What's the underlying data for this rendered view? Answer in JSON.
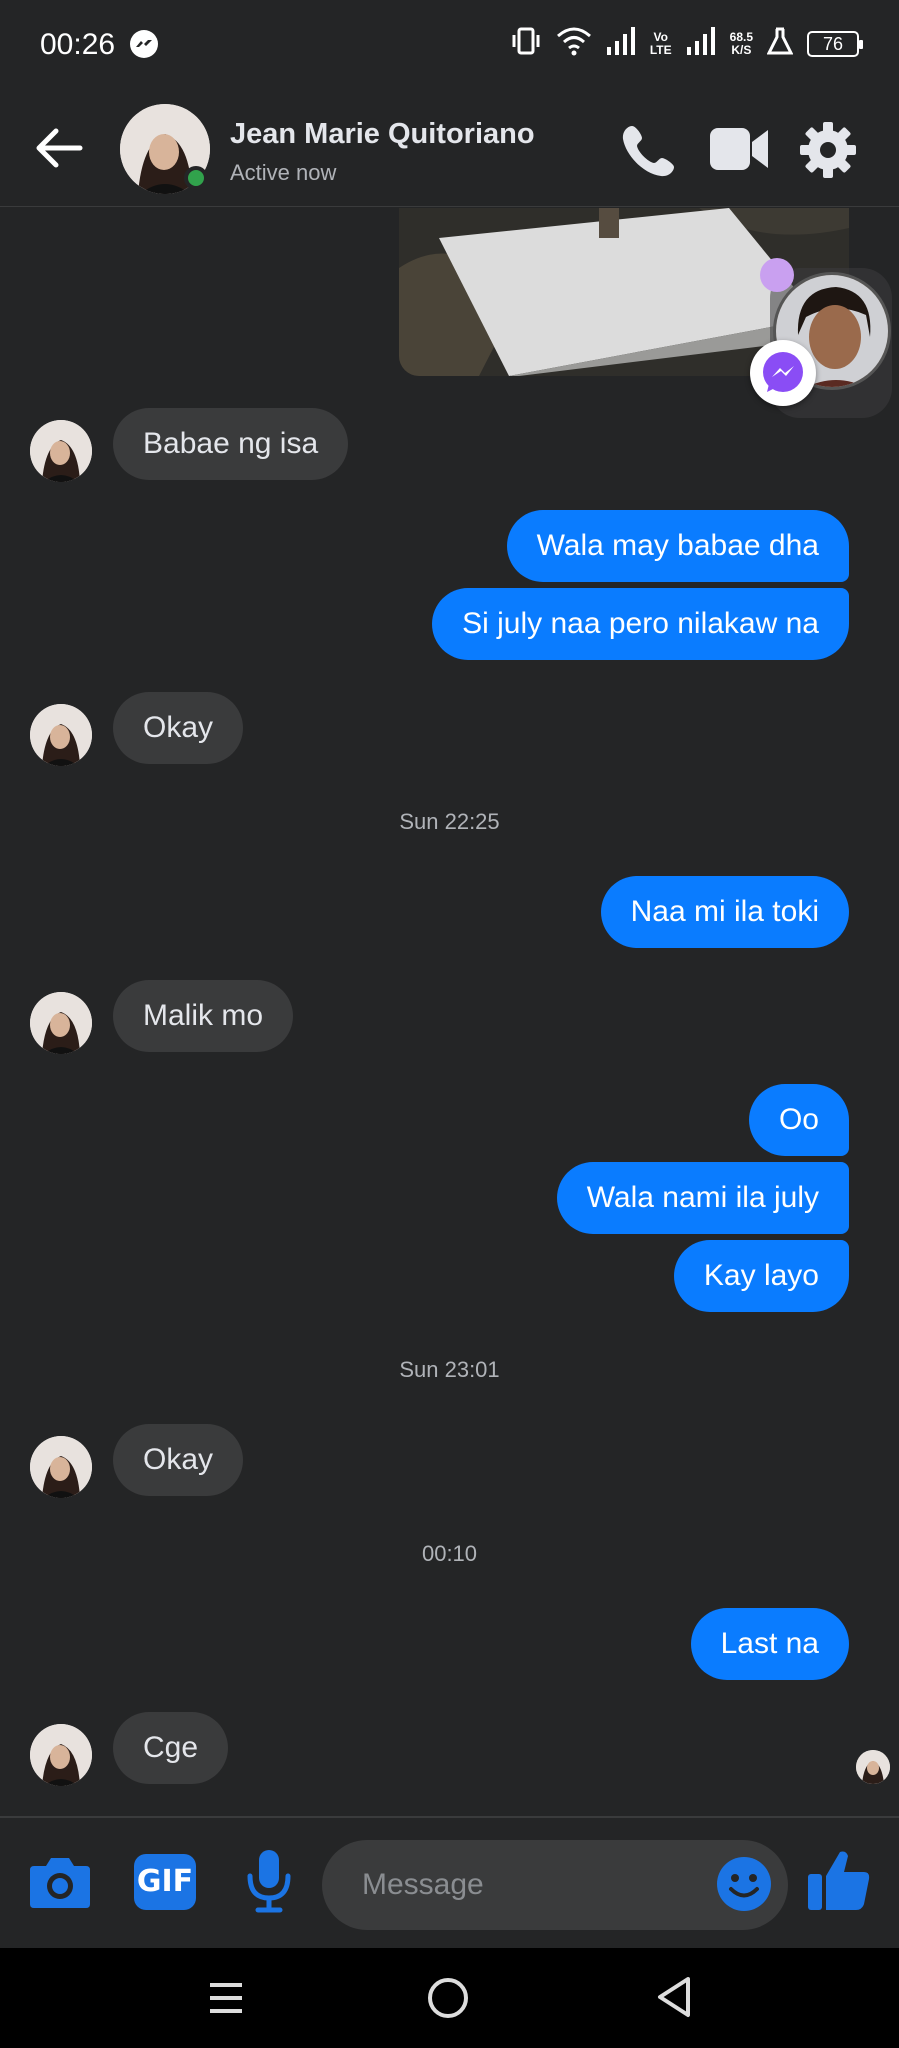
{
  "status_bar": {
    "time": "00:26",
    "volte": "Vo\nLTE",
    "net_speed": "68.5\nK/S",
    "battery": "76"
  },
  "header": {
    "contact_name": "Jean Marie Quitoriano",
    "contact_status": "Active now"
  },
  "messages": {
    "m1": "Babae ng isa",
    "m2": "Wala may babae dha",
    "m3": "Si july naa pero nilakaw na",
    "m4": "Okay",
    "ts1": "Sun 22:25",
    "m5": "Naa mi ila toki",
    "m6": "Malik mo",
    "m7": "Oo",
    "m8": "Wala nami ila july",
    "m9": "Kay layo",
    "ts2": "Sun 23:01",
    "m10": "Okay",
    "ts3": "00:10",
    "m11": "Last na",
    "m12": "Cge"
  },
  "composer": {
    "gif_label": "GIF",
    "placeholder": "Message"
  },
  "colors": {
    "outgoing_bubble": "#0a7cff",
    "incoming_bubble": "#3a3b3c",
    "background": "#242526",
    "accent_icon": "#1b74e4",
    "online": "#31a24c"
  },
  "icons": [
    "messenger-icon",
    "back-arrow-icon",
    "phone-icon",
    "video-camera-icon",
    "gear-icon",
    "camera-icon",
    "gif-icon",
    "microphone-icon",
    "emoji-icon",
    "thumbs-up-icon"
  ]
}
